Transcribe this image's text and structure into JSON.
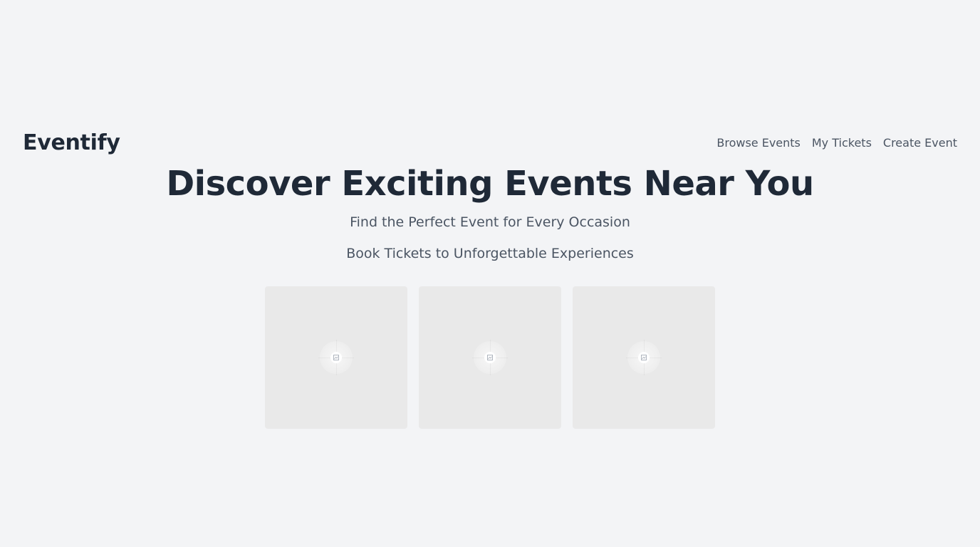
{
  "header": {
    "brand": "Eventify",
    "nav": [
      {
        "label": "Browse Events"
      },
      {
        "label": "My Tickets"
      },
      {
        "label": "Create Event"
      }
    ]
  },
  "hero": {
    "title": "Discover Exciting Events Near You",
    "subtitle": "Find the Perfect Event for Every Occasion",
    "tagline": "Book Tickets to Unforgettable Experiences"
  },
  "cards": [
    {
      "icon": "image-placeholder-icon"
    },
    {
      "icon": "image-placeholder-icon"
    },
    {
      "icon": "image-placeholder-icon"
    }
  ],
  "colors": {
    "background": "#f3f4f6",
    "text_primary": "#1f2937",
    "text_secondary": "#4b5563",
    "card_placeholder": "#e9e9e9"
  }
}
